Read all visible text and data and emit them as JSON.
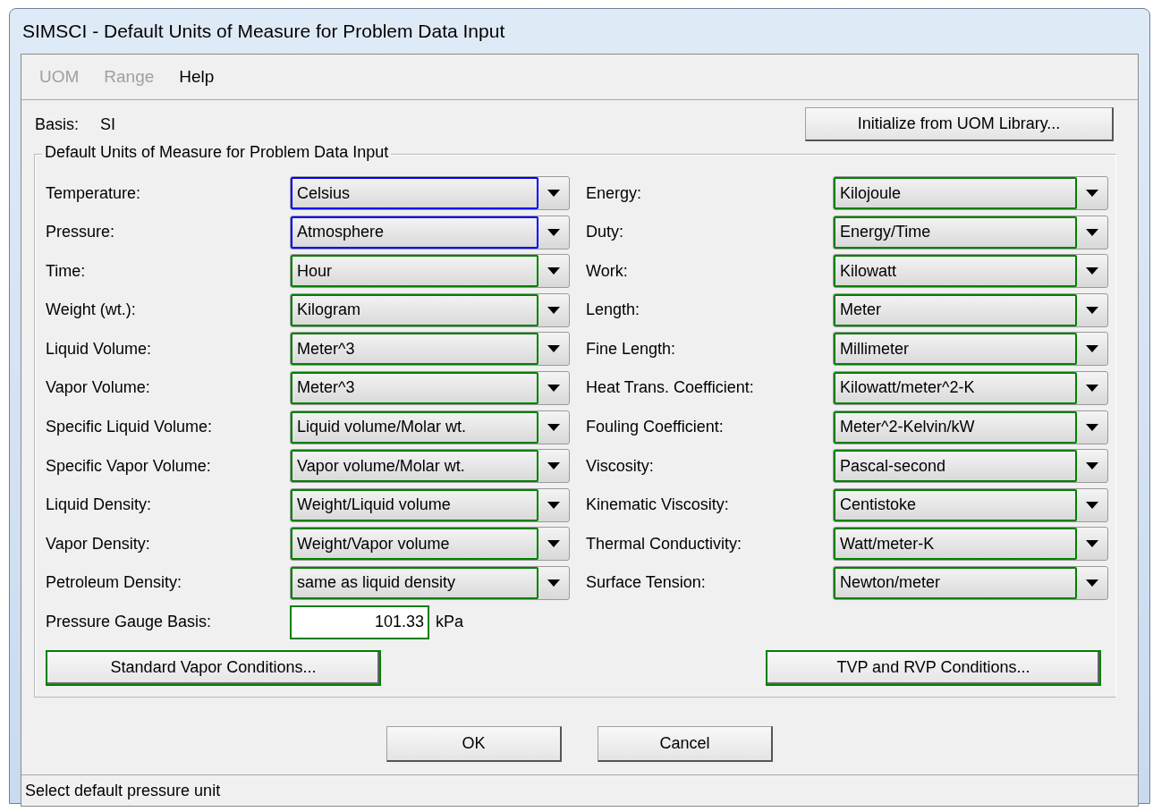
{
  "window": {
    "title": "SIMSCI - Default Units of Measure for Problem Data Input"
  },
  "menu": [
    {
      "label": "UOM",
      "disabled": true
    },
    {
      "label": "Range",
      "disabled": true
    },
    {
      "label": "Help",
      "disabled": false
    }
  ],
  "basis": {
    "label": "Basis:",
    "value": "SI"
  },
  "initialize_button": "Initialize from UOM Library...",
  "group": {
    "title": "Default Units of Measure for Problem Data Input",
    "left_fields": [
      {
        "label": "Temperature:",
        "value": "Celsius",
        "color": "#0000ff"
      },
      {
        "label": "Pressure:",
        "value": "Atmosphere",
        "color": "#0000ff"
      },
      {
        "label": "Time:",
        "value": "Hour",
        "color": "#008000"
      },
      {
        "label": "Weight (wt.):",
        "value": "Kilogram",
        "color": "#008000"
      },
      {
        "label": "Liquid Volume:",
        "value": "Meter^3",
        "color": "#008000"
      },
      {
        "label": "Vapor Volume:",
        "value": "Meter^3",
        "color": "#008000"
      },
      {
        "label": "Specific Liquid Volume:",
        "value": "Liquid volume/Molar wt.",
        "color": "#008000"
      },
      {
        "label": "Specific Vapor Volume:",
        "value": "Vapor volume/Molar wt.",
        "color": "#008000"
      },
      {
        "label": "Liquid Density:",
        "value": "Weight/Liquid volume",
        "color": "#008000"
      },
      {
        "label": "Vapor Density:",
        "value": "Weight/Vapor volume",
        "color": "#008000"
      },
      {
        "label": "Petroleum Density:",
        "value": "same as liquid density",
        "color": "#008000"
      }
    ],
    "right_fields": [
      {
        "label": "Energy:",
        "value": "Kilojoule",
        "color": "#008000"
      },
      {
        "label": "Duty:",
        "value": "Energy/Time",
        "color": "#008000"
      },
      {
        "label": "Work:",
        "value": "Kilowatt",
        "color": "#008000"
      },
      {
        "label": "Length:",
        "value": "Meter",
        "color": "#008000"
      },
      {
        "label": "Fine Length:",
        "value": "Millimeter",
        "color": "#008000"
      },
      {
        "label": "Heat Trans. Coefficient:",
        "value": "Kilowatt/meter^2-K",
        "color": "#008000"
      },
      {
        "label": "Fouling Coefficient:",
        "value": "Meter^2-Kelvin/kW",
        "color": "#008000"
      },
      {
        "label": "Viscosity:",
        "value": "Pascal-second",
        "color": "#008000"
      },
      {
        "label": "Kinematic Viscosity:",
        "value": "Centistoke",
        "color": "#008000"
      },
      {
        "label": "Thermal Conductivity:",
        "value": "Watt/meter-K",
        "color": "#008000"
      },
      {
        "label": "Surface Tension:",
        "value": "Newton/meter",
        "color": "#008000"
      }
    ],
    "pressure_gauge": {
      "label": "Pressure Gauge Basis:",
      "value": "101.33",
      "unit": "kPa",
      "color": "#008000"
    },
    "buttons": [
      {
        "label": "Standard Vapor Conditions...",
        "color": "#008000"
      },
      {
        "label": "TVP and RVP Conditions...",
        "color": "#008000"
      }
    ]
  },
  "dialog_buttons": [
    {
      "label": "OK"
    },
    {
      "label": "Cancel"
    }
  ],
  "status_bar": "Select default pressure unit"
}
